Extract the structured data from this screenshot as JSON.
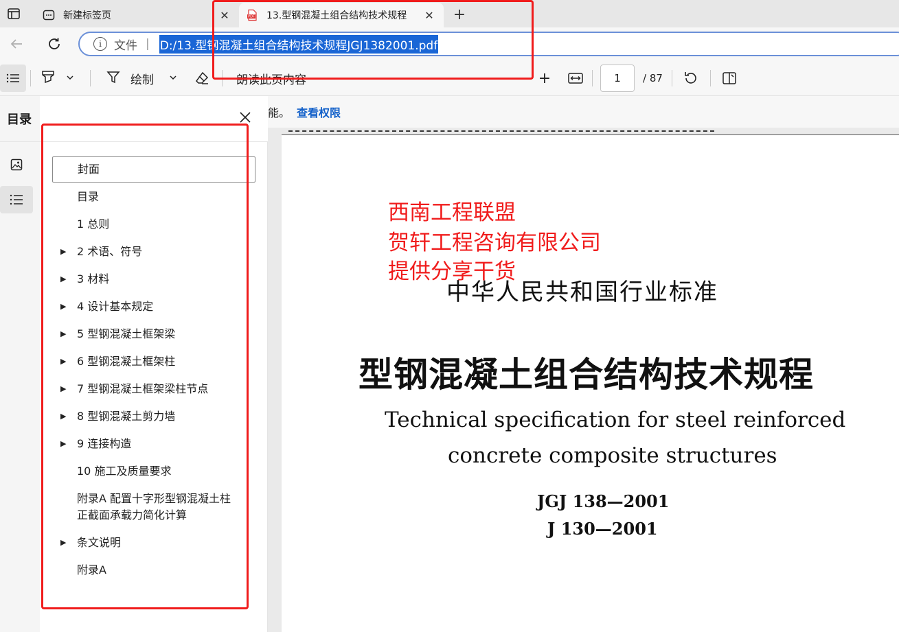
{
  "tabs": [
    {
      "title": "新建标签页",
      "close": "✕"
    },
    {
      "title": "13.型钢混凝土组合结构技术规程",
      "close": "✕",
      "favicon": "PDF"
    }
  ],
  "new_tab": "+",
  "address": {
    "scheme_label": "文件",
    "separator": "|",
    "url": "D:/13.型钢混凝土组合结构技术规程JGJ1382001.pdf"
  },
  "toolbar": {
    "draw_label": "绘制",
    "read_label": "朗读此页内容",
    "plus": "+",
    "page_current": "1",
    "page_total": "/ 87"
  },
  "sidebar": {
    "title": "目录",
    "items": [
      {
        "label": "封面",
        "expandable": false
      },
      {
        "label": "目录",
        "expandable": false
      },
      {
        "label": "1 总则",
        "expandable": false
      },
      {
        "label": "2 术语、符号",
        "expandable": true
      },
      {
        "label": "3 材料",
        "expandable": true
      },
      {
        "label": "4 设计基本规定",
        "expandable": true
      },
      {
        "label": "5 型钢混凝土框架梁",
        "expandable": true
      },
      {
        "label": "6 型钢混凝土框架柱",
        "expandable": true
      },
      {
        "label": "7 型钢混凝土框架梁柱节点",
        "expandable": true
      },
      {
        "label": "8 型钢混凝土剪力墙",
        "expandable": true
      },
      {
        "label": "9 连接构造",
        "expandable": true
      },
      {
        "label": "10 施工及质量要求",
        "expandable": false
      },
      {
        "label": "附录A 配置十字形型钢混凝土柱",
        "label2": "正截面承载力简化计算",
        "expandable": false
      },
      {
        "label": "条文说明",
        "expandable": true
      },
      {
        "label": "附录A",
        "expandable": false
      }
    ]
  },
  "notice": {
    "text": "能。",
    "link": "查看权限"
  },
  "document": {
    "watermark": [
      "西南工程联盟",
      "贺轩工程咨询有限公司",
      "提供分享干货"
    ],
    "standard": "中华人民共和国行业标准",
    "title": "型钢混凝土组合结构技术规程",
    "title_en_1": "Technical specification for steel reinforced",
    "title_en_2": "concrete composite structures",
    "code_1": "JGJ 138—2001",
    "code_2": "J 130—2001"
  },
  "colors": {
    "annotation_red": "#f01c1c",
    "url_highlight": "#1a66d6",
    "link_blue": "#1260c9"
  }
}
